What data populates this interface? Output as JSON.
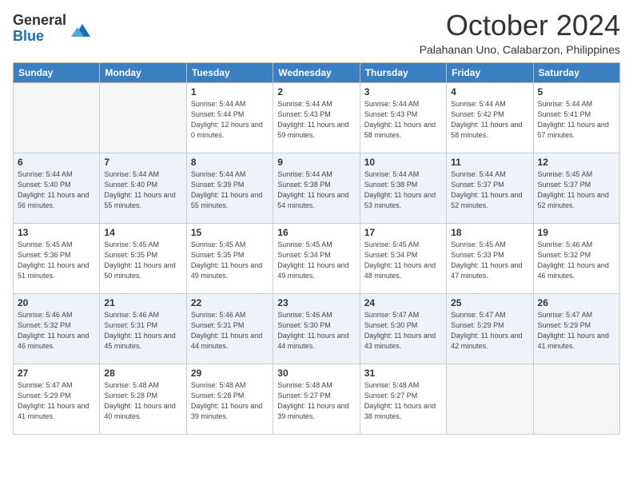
{
  "header": {
    "logo_general": "General",
    "logo_blue": "Blue",
    "month_title": "October 2024",
    "location": "Palahanan Uno, Calabarzon, Philippines"
  },
  "days_of_week": [
    "Sunday",
    "Monday",
    "Tuesday",
    "Wednesday",
    "Thursday",
    "Friday",
    "Saturday"
  ],
  "weeks": [
    [
      {
        "day": "",
        "info": ""
      },
      {
        "day": "",
        "info": ""
      },
      {
        "day": "1",
        "info": "Sunrise: 5:44 AM\nSunset: 5:44 PM\nDaylight: 12 hours and 0 minutes."
      },
      {
        "day": "2",
        "info": "Sunrise: 5:44 AM\nSunset: 5:43 PM\nDaylight: 11 hours and 59 minutes."
      },
      {
        "day": "3",
        "info": "Sunrise: 5:44 AM\nSunset: 5:43 PM\nDaylight: 11 hours and 58 minutes."
      },
      {
        "day": "4",
        "info": "Sunrise: 5:44 AM\nSunset: 5:42 PM\nDaylight: 11 hours and 58 minutes."
      },
      {
        "day": "5",
        "info": "Sunrise: 5:44 AM\nSunset: 5:41 PM\nDaylight: 11 hours and 57 minutes."
      }
    ],
    [
      {
        "day": "6",
        "info": "Sunrise: 5:44 AM\nSunset: 5:40 PM\nDaylight: 11 hours and 56 minutes."
      },
      {
        "day": "7",
        "info": "Sunrise: 5:44 AM\nSunset: 5:40 PM\nDaylight: 11 hours and 55 minutes."
      },
      {
        "day": "8",
        "info": "Sunrise: 5:44 AM\nSunset: 5:39 PM\nDaylight: 11 hours and 55 minutes."
      },
      {
        "day": "9",
        "info": "Sunrise: 5:44 AM\nSunset: 5:38 PM\nDaylight: 11 hours and 54 minutes."
      },
      {
        "day": "10",
        "info": "Sunrise: 5:44 AM\nSunset: 5:38 PM\nDaylight: 11 hours and 53 minutes."
      },
      {
        "day": "11",
        "info": "Sunrise: 5:44 AM\nSunset: 5:37 PM\nDaylight: 11 hours and 52 minutes."
      },
      {
        "day": "12",
        "info": "Sunrise: 5:45 AM\nSunset: 5:37 PM\nDaylight: 11 hours and 52 minutes."
      }
    ],
    [
      {
        "day": "13",
        "info": "Sunrise: 5:45 AM\nSunset: 5:36 PM\nDaylight: 11 hours and 51 minutes."
      },
      {
        "day": "14",
        "info": "Sunrise: 5:45 AM\nSunset: 5:35 PM\nDaylight: 11 hours and 50 minutes."
      },
      {
        "day": "15",
        "info": "Sunrise: 5:45 AM\nSunset: 5:35 PM\nDaylight: 11 hours and 49 minutes."
      },
      {
        "day": "16",
        "info": "Sunrise: 5:45 AM\nSunset: 5:34 PM\nDaylight: 11 hours and 49 minutes."
      },
      {
        "day": "17",
        "info": "Sunrise: 5:45 AM\nSunset: 5:34 PM\nDaylight: 11 hours and 48 minutes."
      },
      {
        "day": "18",
        "info": "Sunrise: 5:45 AM\nSunset: 5:33 PM\nDaylight: 11 hours and 47 minutes."
      },
      {
        "day": "19",
        "info": "Sunrise: 5:46 AM\nSunset: 5:32 PM\nDaylight: 11 hours and 46 minutes."
      }
    ],
    [
      {
        "day": "20",
        "info": "Sunrise: 5:46 AM\nSunset: 5:32 PM\nDaylight: 11 hours and 46 minutes."
      },
      {
        "day": "21",
        "info": "Sunrise: 5:46 AM\nSunset: 5:31 PM\nDaylight: 11 hours and 45 minutes."
      },
      {
        "day": "22",
        "info": "Sunrise: 5:46 AM\nSunset: 5:31 PM\nDaylight: 11 hours and 44 minutes."
      },
      {
        "day": "23",
        "info": "Sunrise: 5:46 AM\nSunset: 5:30 PM\nDaylight: 11 hours and 44 minutes."
      },
      {
        "day": "24",
        "info": "Sunrise: 5:47 AM\nSunset: 5:30 PM\nDaylight: 11 hours and 43 minutes."
      },
      {
        "day": "25",
        "info": "Sunrise: 5:47 AM\nSunset: 5:29 PM\nDaylight: 11 hours and 42 minutes."
      },
      {
        "day": "26",
        "info": "Sunrise: 5:47 AM\nSunset: 5:29 PM\nDaylight: 11 hours and 41 minutes."
      }
    ],
    [
      {
        "day": "27",
        "info": "Sunrise: 5:47 AM\nSunset: 5:29 PM\nDaylight: 11 hours and 41 minutes."
      },
      {
        "day": "28",
        "info": "Sunrise: 5:48 AM\nSunset: 5:28 PM\nDaylight: 11 hours and 40 minutes."
      },
      {
        "day": "29",
        "info": "Sunrise: 5:48 AM\nSunset: 5:28 PM\nDaylight: 11 hours and 39 minutes."
      },
      {
        "day": "30",
        "info": "Sunrise: 5:48 AM\nSunset: 5:27 PM\nDaylight: 11 hours and 39 minutes."
      },
      {
        "day": "31",
        "info": "Sunrise: 5:48 AM\nSunset: 5:27 PM\nDaylight: 11 hours and 38 minutes."
      },
      {
        "day": "",
        "info": ""
      },
      {
        "day": "",
        "info": ""
      }
    ]
  ]
}
